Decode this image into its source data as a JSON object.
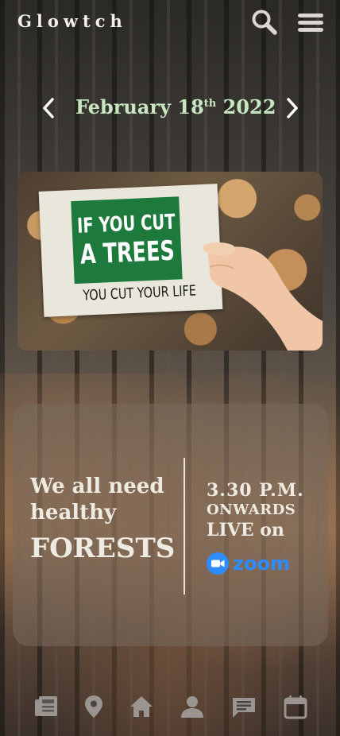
{
  "app": {
    "logo": "Glowtch"
  },
  "header": {
    "search_icon": "search-icon",
    "menu_icon": "hamburger-menu-icon"
  },
  "date_nav": {
    "month_day": "February 18",
    "ordinal": "th",
    "year": " 2022",
    "prev_icon": "chevron-left-icon",
    "next_icon": "chevron-right-icon"
  },
  "banner": {
    "line1": "IF YOU CUT",
    "line2": "A TREES",
    "line3": "YOU CUT YOUR LIFE"
  },
  "event": {
    "tagline_line1": "We all need",
    "tagline_line2": "healthy",
    "tagline_big": "FORESTS",
    "time": "3.30 P.M.",
    "onwards": "ONWARDS",
    "live": "LIVE on",
    "platform": "zoom"
  },
  "bottom_nav": {
    "items": [
      {
        "icon": "news-icon"
      },
      {
        "icon": "location-pin-icon"
      },
      {
        "icon": "home-icon"
      },
      {
        "icon": "user-icon"
      },
      {
        "icon": "chat-icon"
      },
      {
        "icon": "calendar-icon"
      }
    ]
  },
  "colors": {
    "accent_date": "#c7e7c1",
    "zoom_blue": "#2d8cff",
    "icon_gray": "#9a9590"
  }
}
